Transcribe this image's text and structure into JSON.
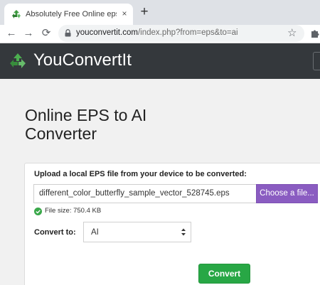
{
  "browser": {
    "tab_title": "Absolutely Free Online eps to ai c",
    "tab_close": "×",
    "new_tab": "+",
    "back": "←",
    "forward": "→",
    "reload": "⟳",
    "star": "☆",
    "url_host": "youconvertit.com",
    "url_rest": "/index.php?from=eps&to=ai",
    "icons": {
      "favicon": "recycle-favicon-icon",
      "lock": "lock-icon",
      "star": "star-icon",
      "extensions": "puzzle-icon"
    }
  },
  "header": {
    "brand": "YouConvertIt",
    "logo_icon": "recycle-logo-icon",
    "colors": {
      "background": "#34383c",
      "logo": "#4caf50"
    }
  },
  "main": {
    "title": "Online EPS to AI Converter",
    "upload_label": "Upload a local EPS file from your device to be converted:",
    "file_name": "different_color_butterfly_sample_vector_528745.eps",
    "choose_button": "Choose a file...",
    "file_size": "File size: 750.4 KB",
    "convert_to_label": "Convert to:",
    "format_selected": "AI",
    "convert_button": "Convert",
    "colors": {
      "choose": "#8a5cc1",
      "convert": "#28a745",
      "check": "#3aa84a"
    }
  }
}
